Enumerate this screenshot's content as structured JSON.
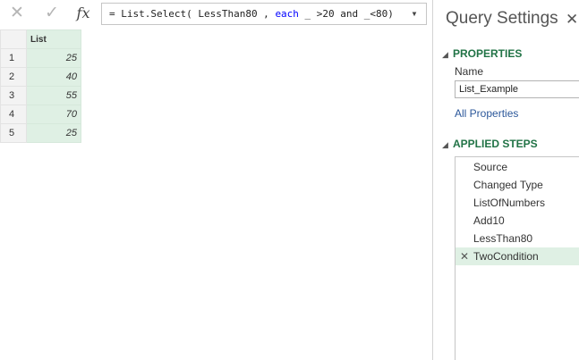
{
  "formula_bar": {
    "formula_prefix": "= List.Select( LessThan80 , ",
    "formula_kw": "each",
    "formula_suffix": " _ >20 and _<80)"
  },
  "grid": {
    "column_header": "List",
    "rows": [
      {
        "row": "1",
        "value": "25"
      },
      {
        "row": "2",
        "value": "40"
      },
      {
        "row": "3",
        "value": "55"
      },
      {
        "row": "4",
        "value": "70"
      },
      {
        "row": "5",
        "value": "25"
      }
    ]
  },
  "query_settings": {
    "title": "Query Settings",
    "properties_header": "PROPERTIES",
    "name_label": "Name",
    "name_value": "List_Example",
    "all_properties_link": "All Properties",
    "applied_steps_header": "APPLIED STEPS",
    "steps": [
      "Source",
      "Changed Type",
      "ListOfNumbers",
      "Add10",
      "LessThan80",
      "TwoCondition"
    ],
    "active_step_index": 5
  },
  "colors": {
    "accent_green": "#217346",
    "selected_fill": "#dff0e4",
    "link_blue": "#2b579a"
  }
}
